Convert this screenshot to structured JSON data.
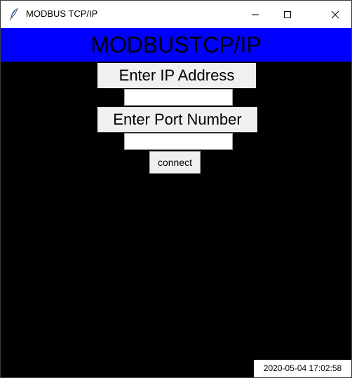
{
  "window": {
    "title": "MODBUS TCP/IP",
    "app_icon": "feather-icon",
    "controls": {
      "minimize_icon": "minimize-icon",
      "maximize_icon": "maximize-icon",
      "close_icon": "close-icon"
    }
  },
  "banner": {
    "text": "MODBUSTCP/IP",
    "background": "#0000ff"
  },
  "form": {
    "ip_label": "Enter IP Address",
    "ip_value": "",
    "port_label": "Enter Port Number",
    "port_value": "",
    "connect_label": "connect"
  },
  "status": {
    "timestamp": "2020-05-04 17:02:58"
  },
  "colors": {
    "background": "#000000",
    "banner": "#0000ff",
    "label_bg": "#f0f0f0"
  }
}
